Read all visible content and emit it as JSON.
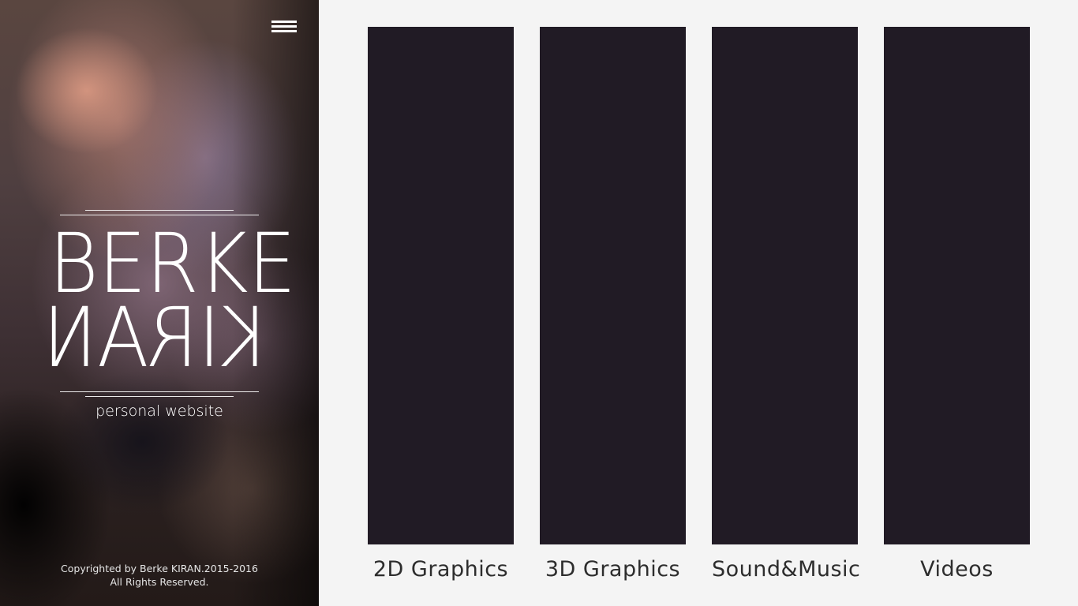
{
  "sidebar": {
    "menu_icon": "hamburger-menu-icon",
    "logo": {
      "line1": "BERKE",
      "line2": "KIRAN",
      "subtitle": "personal website"
    },
    "footer": {
      "line1": "Copyrighted by Berke KIRAN.2015-2016",
      "line2": "All Rights Reserved."
    }
  },
  "categories": [
    {
      "label": "2D Graphics"
    },
    {
      "label": "3D Graphics"
    },
    {
      "label": "Sound&Music"
    },
    {
      "label": "Videos"
    }
  ],
  "colors": {
    "page_background": "#f4f4f4",
    "card_background": "#211b25",
    "label_text": "#2d2d2d",
    "sidebar_text": "#ffffff"
  }
}
